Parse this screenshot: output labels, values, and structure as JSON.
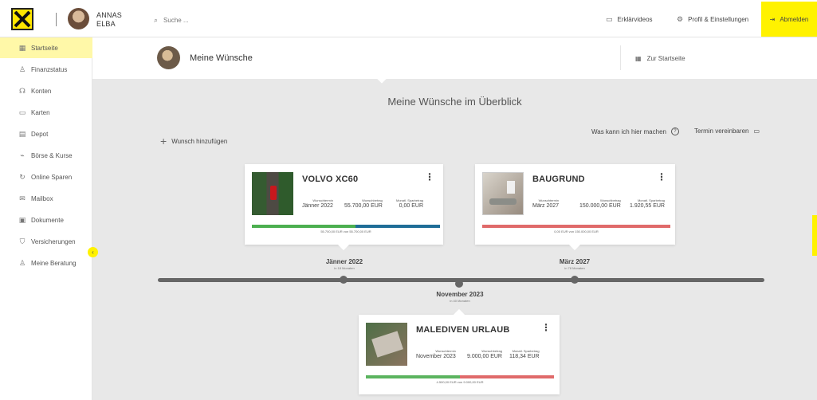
{
  "header": {
    "user_name_line1": "ANNAS",
    "user_name_line2": "ELBA",
    "search_placeholder": "Suche ...",
    "links": [
      {
        "label": "Erklärvideos",
        "icon": "video-icon"
      },
      {
        "label": "Profil & Einstellungen",
        "icon": "gear-icon"
      }
    ],
    "logout_label": "Abmelden",
    "logout_icon": "logout-icon"
  },
  "sidebar": {
    "items": [
      {
        "label": "Startseite",
        "icon": "grid-icon",
        "active": true
      },
      {
        "label": "Finanzstatus",
        "icon": "person-money-icon"
      },
      {
        "label": "Konten",
        "icon": "hand-coin-icon"
      },
      {
        "label": "Karten",
        "icon": "card-icon"
      },
      {
        "label": "Depot",
        "icon": "document-icon"
      },
      {
        "label": "Börse & Kurse",
        "icon": "chart-icon"
      },
      {
        "label": "Online Sparen",
        "icon": "refresh-icon"
      },
      {
        "label": "Mailbox",
        "icon": "mail-icon"
      },
      {
        "label": "Dokumente",
        "icon": "files-icon"
      },
      {
        "label": "Versicherungen",
        "icon": "shield-icon"
      },
      {
        "label": "Meine Beratung",
        "icon": "advisor-icon"
      }
    ]
  },
  "subheader": {
    "title": "Meine Wünsche",
    "home_link": "Zur Startseite"
  },
  "overview": {
    "title": "Meine Wünsche im Überblick",
    "add_wish": "Wunsch hinzufügen",
    "help_question": "Was kann ich hier machen",
    "appointment": "Termin vereinbaren"
  },
  "wishes": [
    {
      "title": "VOLVO XC60",
      "metrics": [
        {
          "label": "Wunschtermin",
          "value": "Jänner 2022"
        },
        {
          "label": "Wunschbetrag",
          "value": "55.700,00 EUR"
        },
        {
          "label": "Monatl. Sparbetrag",
          "value": "0,00 EUR"
        }
      ],
      "progress": 1,
      "bar_color": "#1f6d97",
      "bar_start_color": "#4caf50",
      "progress_text": "55.700,00 EUR von 55.700,00 EUR"
    },
    {
      "title": "BAUGRUND",
      "metrics": [
        {
          "label": "Wunschtermin",
          "value": "März 2027"
        },
        {
          "label": "Wunschbetrag",
          "value": "150.000,00 EUR"
        },
        {
          "label": "Monatl. Sparbetrag",
          "value": "1.920,55 EUR"
        }
      ],
      "progress": 0,
      "bar_color": "#e06a6a",
      "bar_start_color": "#e06a6a",
      "progress_text": "0,00 EUR von 150.000,00 EUR"
    },
    {
      "title": "MALEDIVEN URLAUB",
      "metrics": [
        {
          "label": "Wunschtermin",
          "value": "November 2023"
        },
        {
          "label": "Wunschbetrag",
          "value": "9.000,00 EUR"
        },
        {
          "label": "Monatl. Sparbetrag",
          "value": "118,34 EUR"
        }
      ],
      "progress": 0.5,
      "bar_color": "#e06a6a",
      "bar_start_color": "#5bb45f",
      "progress_text": "4.500,00 EUR von 9.000,00 EUR"
    }
  ],
  "timeline": [
    {
      "date": "Jänner 2022",
      "sub": "in 18 Monaten"
    },
    {
      "date": "März 2027",
      "sub": "in 78 Monaten"
    },
    {
      "date": "November 2023",
      "sub": "in 40 Monaten"
    }
  ]
}
